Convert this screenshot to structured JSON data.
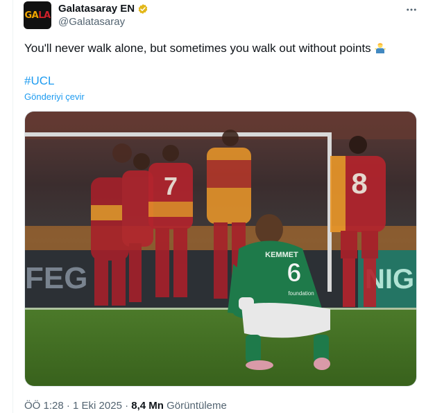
{
  "author": {
    "display_name": "Galatasaray EN",
    "handle": "@Galatasaray",
    "avatar_text_a": "GA",
    "avatar_text_b": "LA"
  },
  "tweet": {
    "text": "You'll never walk alone, but sometimes you walk out without points",
    "emoji": "person-shrugging",
    "hashtag": "#UCL",
    "translate_label": "Gönderiyi çevir"
  },
  "media": {
    "shirt_numbers": [
      "7",
      "8",
      "6"
    ],
    "kit_text": "KEMMET",
    "sponsor_text": "foundation",
    "board_text_left": "FEG",
    "board_text_right": "NIG"
  },
  "meta": {
    "time": "ÖÖ 1:28",
    "date": "1 Eki 2025",
    "views_count": "8,4 Mn",
    "views_label": "Görüntüleme"
  },
  "colors": {
    "link": "#1d9bf0",
    "secondary_text": "#536471",
    "verified": "#e2b719",
    "galatasaray_red": "#a8202a",
    "galatasaray_yellow": "#e8962a",
    "celtic_green": "#1e7a4a"
  }
}
